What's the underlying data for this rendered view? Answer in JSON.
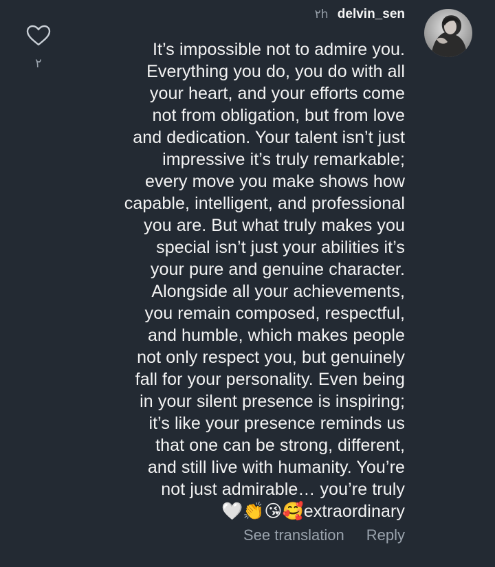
{
  "comment": {
    "timestamp": "٢h",
    "username": "delvin_sen",
    "like_count": "٢",
    "body_text": "It’s impossible not to admire you.\nEverything you do, you do with all\nyour heart, and your efforts come\nnot from obligation, but from love\nand dedication. Your talent isn’t just\nimpressive it’s truly remarkable;\nevery move you make shows how\ncapable, intelligent, and professional\nyou are. But what truly makes you\nspecial isn’t just your abilities it’s\nyour pure and genuine character.\nAlongside all your achievements,\nyou remain composed, respectful,\nand humble, which makes people\nnot only respect you, but genuinely\nfall for your personality. Even being\nin your silent presence is inspiring;\nit’s like your presence reminds us\nthat one can be strong, different,\nand still live with humanity. You’re\nnot just admirable… you’re truly\n🤍👏😘🥰extraordinary",
    "actions": {
      "see_translation": "See translation",
      "reply": "Reply"
    }
  },
  "icons": {
    "like": "heart-outline-icon",
    "avatar": "profile-photo"
  },
  "colors": {
    "background": "#232a33",
    "text": "#f3f3f3",
    "muted": "#9aa3ad"
  }
}
